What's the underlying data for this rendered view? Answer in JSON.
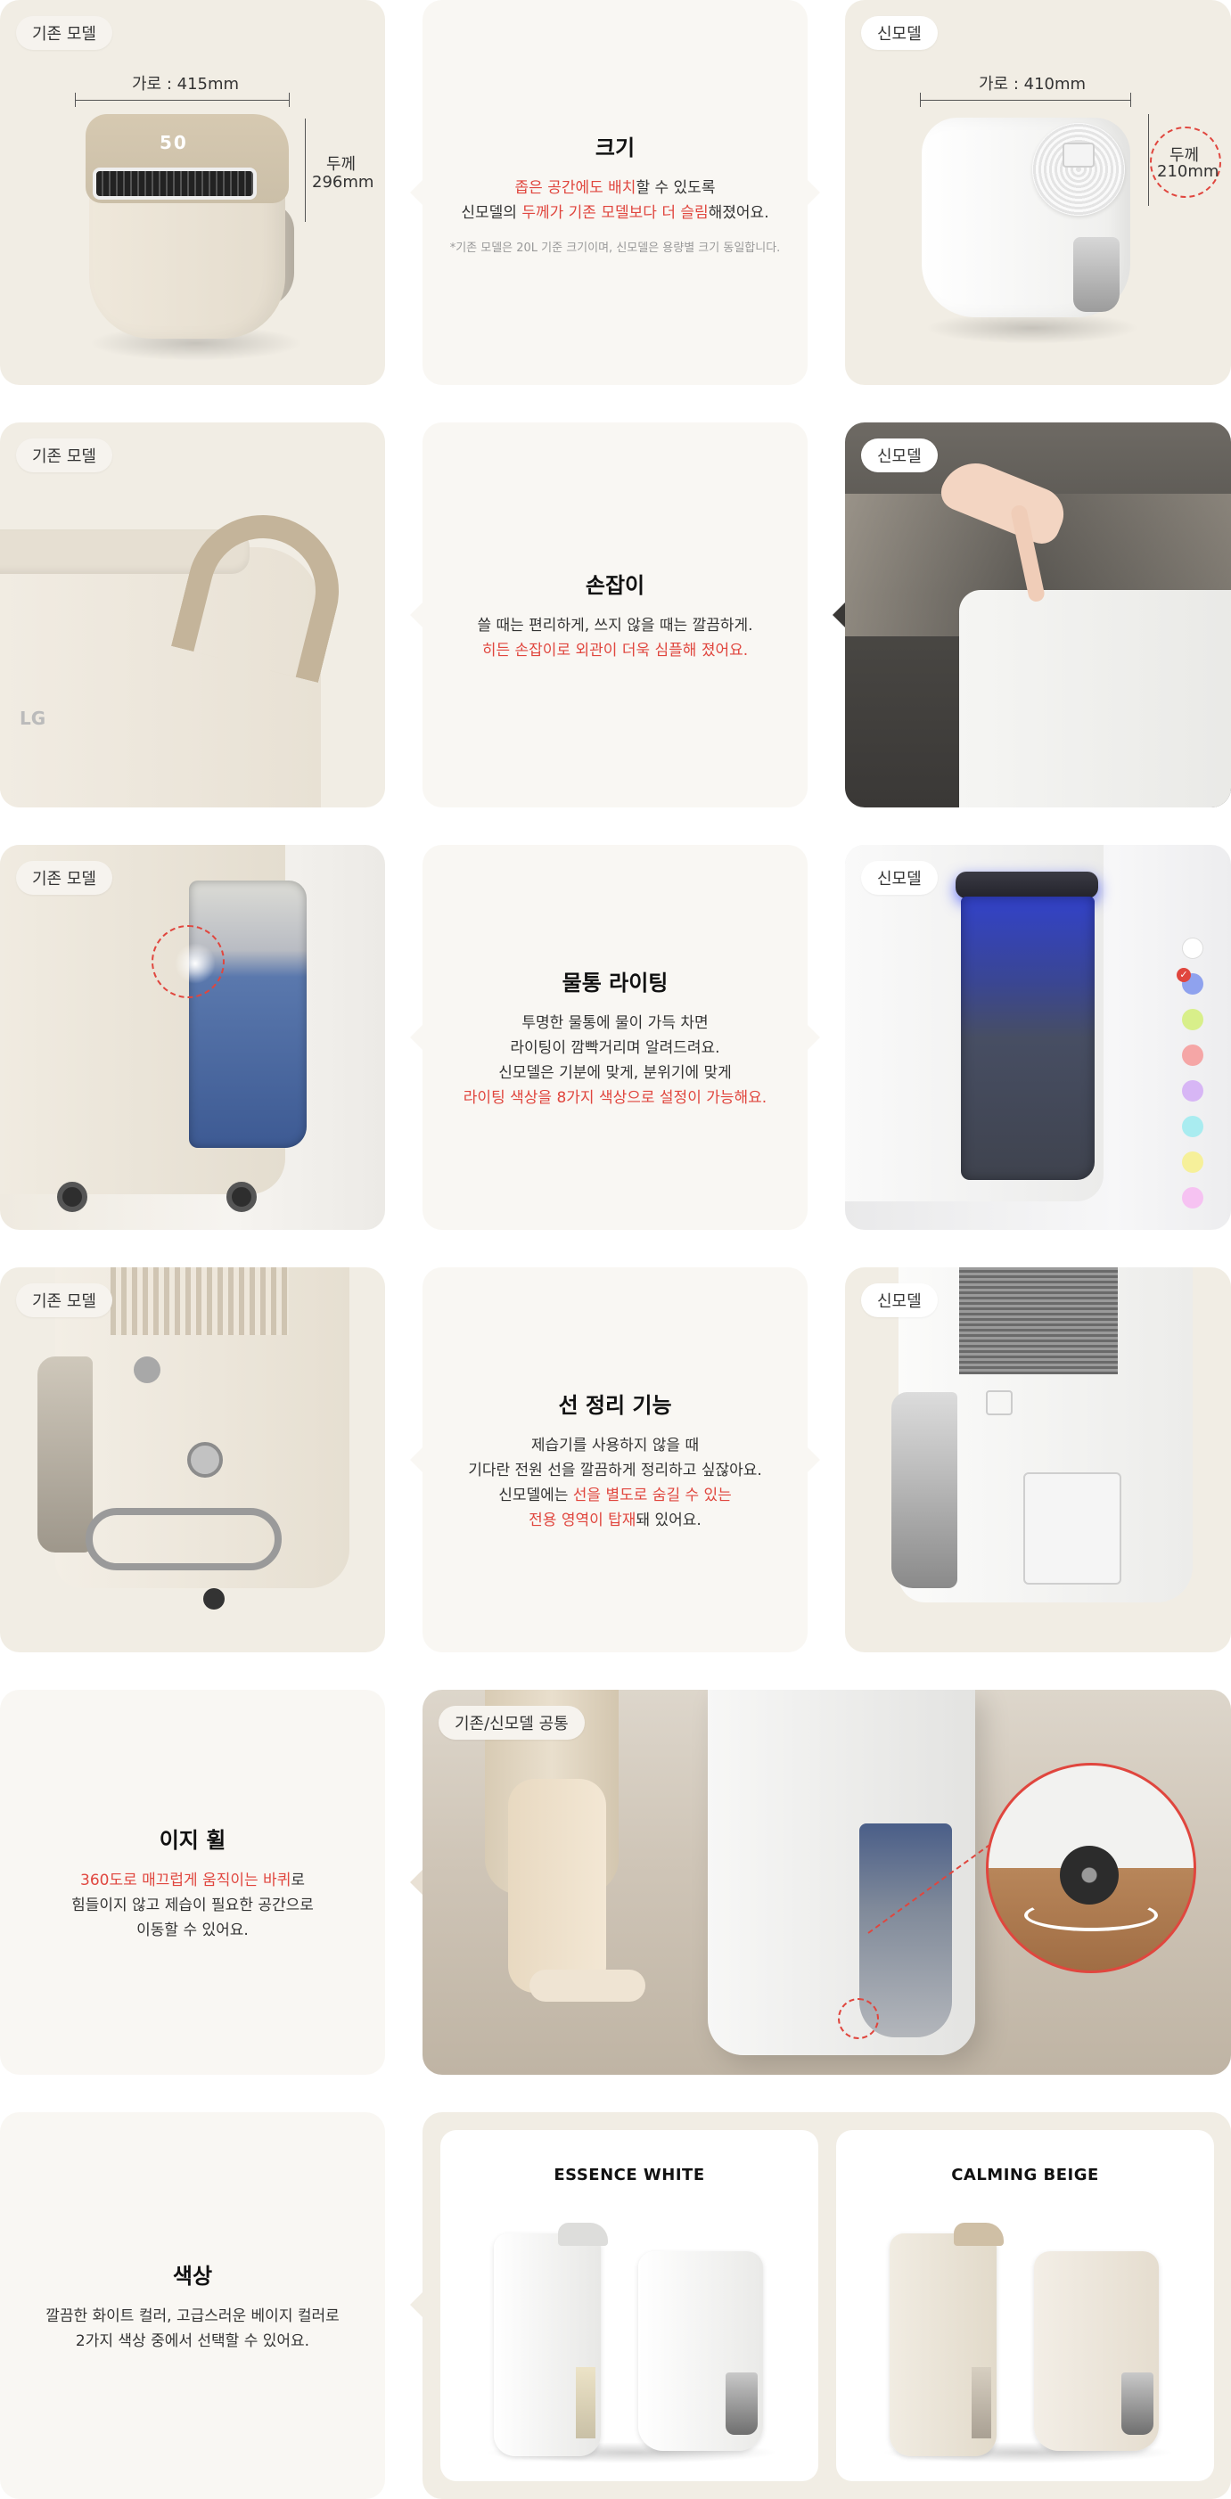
{
  "tags": {
    "old": "기존 모델",
    "new": "신모델",
    "common": "기존/신모델 공통"
  },
  "size": {
    "old_width": "가로 : 415mm",
    "old_depth_label": "두께",
    "old_depth_value": "296mm",
    "new_width": "가로 : 410mm",
    "new_depth_label": "두께",
    "new_depth_value": "210mm",
    "display_number": "50",
    "title": "크기",
    "l1_red": "좁은 공간에도 배치",
    "l1_rest": "할 수 있도록",
    "l2_a": "신모델의 ",
    "l2_red": "두께가 기존 모델보다 더 슬림",
    "l2_rest": "해졌어요.",
    "note": "*기존 모델은 20L 기준 크기이며, 신모델은 용량별 크기 동일합니다."
  },
  "handle": {
    "title": "손잡이",
    "l1": "쓸 때는 편리하게, 쓰지 않을 때는 깔끔하게.",
    "l2_red": "히든 손잡이로 외관이 더욱 심플해 졌어요.",
    "logo": "LG"
  },
  "lighting": {
    "title": "물통 라이팅",
    "l1": "투명한 물통에 물이 가득 차면",
    "l2": "라이팅이 깜빡거리며 알려드려요.",
    "l3": "신모델은 기분에 맞게, 분위기에 맞게",
    "l4_red": "라이팅 색상을 8가지 색상으로 설정이 가능해요.",
    "swatches": [
      "#ffffff",
      "#8fa2ee",
      "#d8ef8a",
      "#f5a6a6",
      "#d7b6f5",
      "#a9ecf0",
      "#f6f09a",
      "#f6c2f2"
    ],
    "check_glyph": "✓"
  },
  "cord": {
    "title": "선 정리 기능",
    "l1": "제습기를 사용하지 않을 때",
    "l2": "기다란 전원 선을 깔끔하게 정리하고 싶잖아요.",
    "l3_a": "신모델에는 ",
    "l3_red": "선을 별도로 숨길 수 있는",
    "l4_red": "전용 영역이 탑재",
    "l4_rest": "돼 있어요."
  },
  "wheel": {
    "title": "이지 휠",
    "l1_red": "360도로 매끄럽게 움직이는 바퀴",
    "l1_rest": "로",
    "l2": "힘들이지 않고 제습이 필요한 공간으로",
    "l3": "이동할 수 있어요."
  },
  "color": {
    "title": "색상",
    "l1": "깔끔한 화이트 컬러, 고급스러운 베이지 컬러로",
    "l2": "2가지 색상 중에서 선택할 수 있어요.",
    "essence": "ESSENCE WHITE",
    "calming": "CALMING BEIGE"
  },
  "colors": {
    "accent_red": "#e0463e",
    "card_beige": "#f1ede4",
    "card_text_bg": "#f9f7f3",
    "product_beige": "#ece5d8",
    "product_white": "#f7f7f5"
  }
}
